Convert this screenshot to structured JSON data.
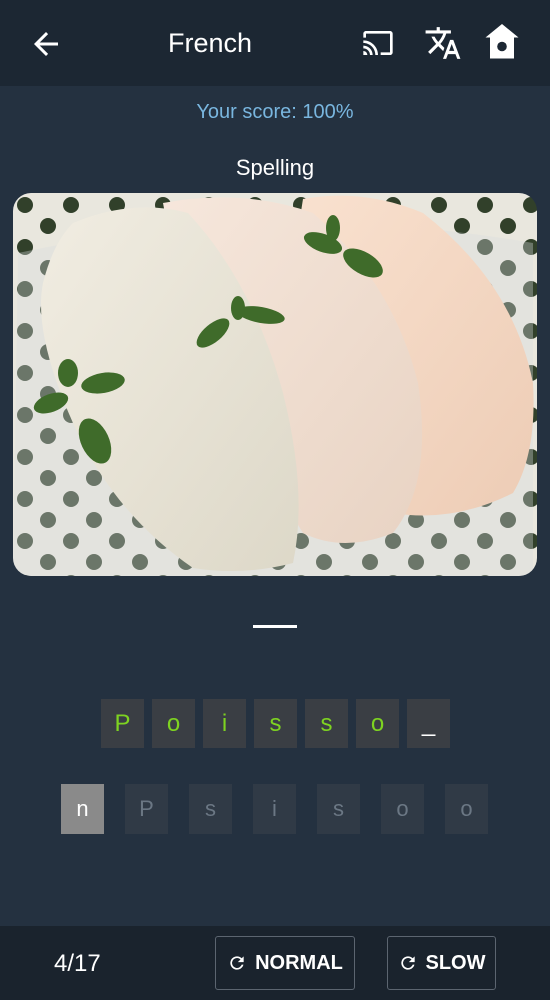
{
  "header": {
    "title": "French",
    "icons": [
      "back-arrow-icon",
      "cast-icon",
      "translate-icon",
      "home-icon"
    ]
  },
  "score_text": "Your score: 100%",
  "mode_label": "Spelling",
  "answer_tiles": [
    "P",
    "o",
    "i",
    "s",
    "s",
    "o",
    "_"
  ],
  "choice_tiles": [
    "n",
    "P",
    "s",
    "i",
    "s",
    "o",
    "o"
  ],
  "footer": {
    "progress": "4/17",
    "normal_label": "NORMAL",
    "slow_label": "SLOW"
  },
  "colors": {
    "background": "#243140",
    "topbar": "#1c2733",
    "score_text": "#79b6df",
    "correct_letter": "#7ed321",
    "active_tile": "#8a8a8a"
  }
}
